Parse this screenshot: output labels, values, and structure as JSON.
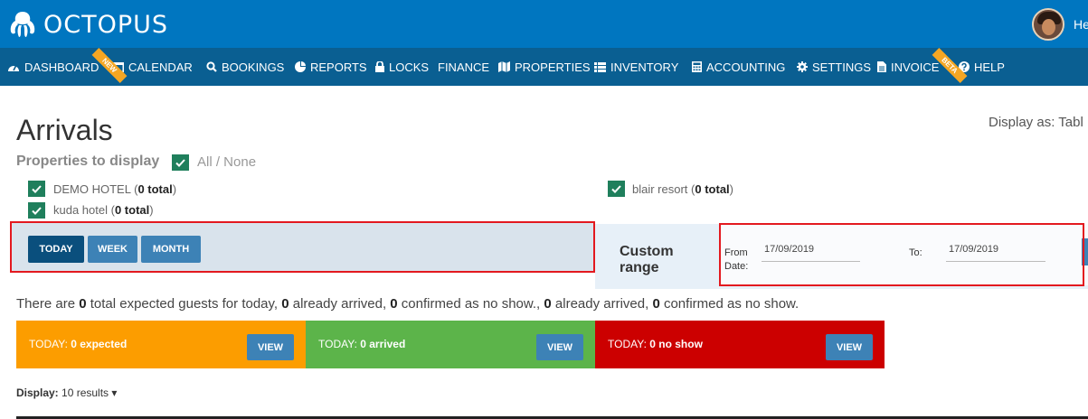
{
  "brand": {
    "name": "OCTOPUS"
  },
  "user": {
    "greeting": "Hey"
  },
  "nav": {
    "items": [
      {
        "label": "DASHBOARD",
        "icon": "dashboard-icon",
        "badge": "NEW"
      },
      {
        "label": "CALENDAR",
        "icon": "calendar-icon"
      },
      {
        "label": "BOOKINGS",
        "icon": "search-icon"
      },
      {
        "label": "REPORTS",
        "icon": "pie-chart-icon"
      },
      {
        "label": "LOCKS",
        "icon": "lock-icon"
      },
      {
        "label": "FINANCE"
      },
      {
        "label": "PROPERTIES",
        "icon": "map-icon"
      },
      {
        "label": "INVENTORY",
        "icon": "list-icon"
      },
      {
        "label": "ACCOUNTING",
        "icon": "calculator-icon"
      },
      {
        "label": "SETTINGS",
        "icon": "gear-icon"
      },
      {
        "label": "INVOICE",
        "icon": "file-icon",
        "badge": "BETA"
      },
      {
        "label": "HELP",
        "icon": "help-icon"
      }
    ]
  },
  "page": {
    "title": "Arrivals",
    "display_as": "Display as: Tabl"
  },
  "properties": {
    "label": "Properties to display",
    "all_none": "All / None",
    "items": [
      {
        "name": "DEMO HOTEL",
        "total": "0 total"
      },
      {
        "name": "kuda hotel",
        "total": "0 total"
      },
      {
        "name": "blair resort",
        "total": "0 total"
      }
    ]
  },
  "range": {
    "buttons": [
      "TODAY",
      "WEEK",
      "MONTH"
    ],
    "custom_label": "Custom range",
    "from_label": "From Date:",
    "from_value": "17/09/2019",
    "to_label": "To:",
    "to_value": "17/09/2019"
  },
  "summary": {
    "p1": "There are ",
    "n1": "0",
    "p2": " total expected guests for today, ",
    "n2": "0",
    "p3": " already arrived, ",
    "n3": "0",
    "p4": " confirmed as no show., ",
    "n4": "0",
    "p5": " already arrived, ",
    "n5": "0",
    "p6": " confirmed as no show."
  },
  "cards": [
    {
      "prefix": "TODAY: ",
      "value": "0 expected",
      "button": "VIEW",
      "color": "#fc9d00"
    },
    {
      "prefix": "TODAY: ",
      "value": "0 arrived",
      "button": "VIEW",
      "color": "#5cb44a"
    },
    {
      "prefix": "TODAY: ",
      "value": "0 no show",
      "button": "VIEW",
      "color": "#cc0000"
    }
  ],
  "display": {
    "label": "Display:",
    "value": "10 results",
    "caret": "▾"
  },
  "colors": {
    "topbar": "#0076c0",
    "navbar": "#0a5f92",
    "highlight": "#e3191f",
    "check": "#1f7f5c"
  }
}
